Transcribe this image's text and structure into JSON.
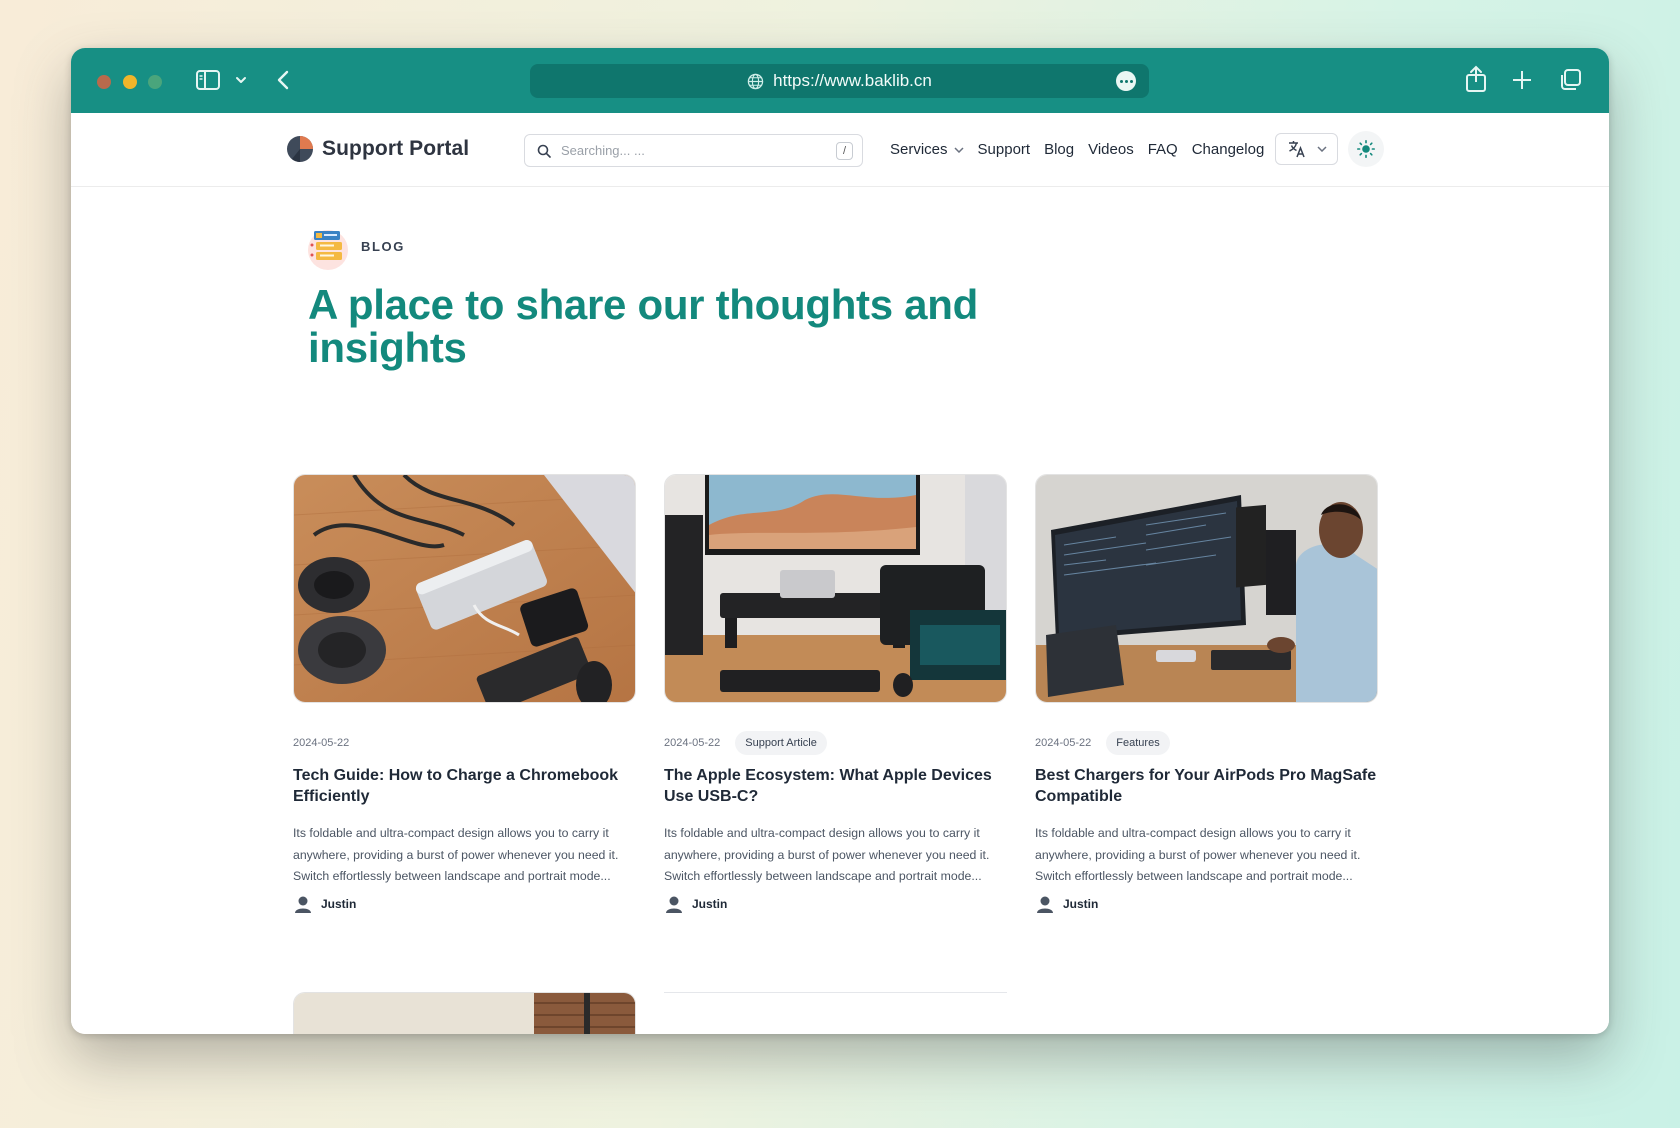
{
  "browser": {
    "url": "https://www.baklib.cn"
  },
  "header": {
    "brand": "Support Portal",
    "search_placeholder": "Searching... ...",
    "search_shortcut": "/",
    "nav": [
      {
        "label": "Services",
        "has_dropdown": true
      },
      {
        "label": "Support"
      },
      {
        "label": "Blog"
      },
      {
        "label": "Videos"
      },
      {
        "label": "FAQ"
      },
      {
        "label": "Changelog"
      }
    ],
    "language_icon": "translate-icon",
    "theme_icon": "sun-icon"
  },
  "hero": {
    "eyebrow": "BLOG",
    "title": "A place to share our thoughts and insights",
    "accent_color": "#13897d"
  },
  "posts": [
    {
      "date": "2024-05-22",
      "tag": "",
      "title": "Tech Guide: How to Charge a Chromebook Efficiently",
      "excerpt": "Its foldable and ultra-compact design allows you to carry it anywhere, providing a burst of power whenever you need it. Switch effortlessly between landscape and portrait mode...",
      "author": "Justin"
    },
    {
      "date": "2024-05-22",
      "tag": "Support Article",
      "title": "The Apple Ecosystem: What Apple Devices Use USB-C?",
      "excerpt": "Its foldable and ultra-compact design allows you to carry it anywhere, providing a burst of power whenever you need it. Switch effortlessly between landscape and portrait mode...",
      "author": "Justin"
    },
    {
      "date": "2024-05-22",
      "tag": "Features",
      "title": "Best Chargers for Your AirPods Pro MagSafe Compatible",
      "excerpt": "Its foldable and ultra-compact design allows you to carry it anywhere, providing a burst of power whenever you need it. Switch effortlessly between landscape and portrait mode...",
      "author": "Justin"
    }
  ]
}
